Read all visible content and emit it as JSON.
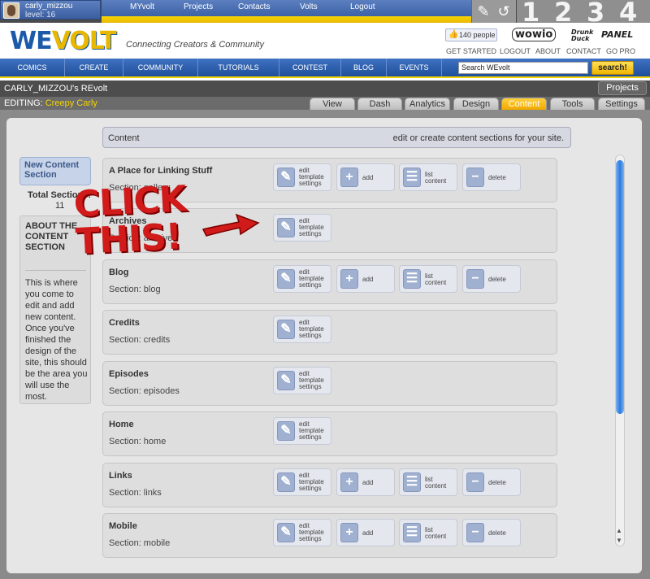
{
  "topbar": {
    "username": "carly_mizzou",
    "level": "level: 16",
    "nav": [
      "MYvolt",
      "Projects",
      "Contacts",
      "Volts",
      "Logout"
    ],
    "steps": [
      "1",
      "2",
      "3",
      "4"
    ]
  },
  "header": {
    "logo_we": "WE",
    "logo_volt": "VOLT",
    "tagline": "Connecting Creators & Community",
    "like_count": "140 people",
    "partner_logos": [
      "wowio",
      "Drunk Duck",
      "PANEL"
    ],
    "links": [
      "GET STARTED",
      "LOGOUT",
      "ABOUT",
      "CONTACT",
      "GO PRO"
    ]
  },
  "mainnav": {
    "items": [
      "COMICS",
      "CREATE",
      "COMMUNITY",
      "TUTORIALS",
      "CONTEST",
      "BLOG",
      "EVENTS"
    ],
    "search_value": "Search WEvolt",
    "search_button": "search!"
  },
  "titlebar": {
    "title": "CARLY_MIZZOU's REvolt",
    "projects": "Projects",
    "editing_label": "EDITING:",
    "editing_name": "Creepy Carly",
    "tabs": [
      "View",
      "Dash",
      "Analytics",
      "Design",
      "Content",
      "Tools",
      "Settings"
    ],
    "active_tab": "Content"
  },
  "sidebar": {
    "new_content": "New Content Section",
    "total_label": "Total Sections:",
    "total_value": "11",
    "about_heading": "ABOUT THE CONTENT SECTION",
    "about_text": "This is where you come to edit and add new content. Once you've finished the design of the site, this should be the area you will use the most."
  },
  "content_header": {
    "left": "Content",
    "right": "edit or create content sections for your site."
  },
  "actions": {
    "edit": [
      "edit",
      "template",
      "settings"
    ],
    "add": "add",
    "list": [
      "list",
      "content"
    ],
    "delete": "delete"
  },
  "sections": [
    {
      "name": "A Place for Linking Stuff",
      "sub": "Section: gallery",
      "full": true
    },
    {
      "name": "Archives",
      "sub": "Section: archives",
      "full": false
    },
    {
      "name": "Blog",
      "sub": "Section: blog",
      "full": true
    },
    {
      "name": "Credits",
      "sub": "Section: credits",
      "full": false
    },
    {
      "name": "Episodes",
      "sub": "Section: episodes",
      "full": false
    },
    {
      "name": "Home",
      "sub": "Section: home",
      "full": false
    },
    {
      "name": "Links",
      "sub": "Section: links",
      "full": true
    },
    {
      "name": "Mobile",
      "sub": "Section: mobile",
      "full": true
    }
  ],
  "annotation": {
    "text_line1": "CLICK",
    "text_line2": "THIS!",
    "color": "#d11a1a"
  },
  "colors": {
    "brand_blue": "#1a5aa8",
    "brand_yellow": "#f5d400",
    "active_tab": "#f0a800"
  }
}
